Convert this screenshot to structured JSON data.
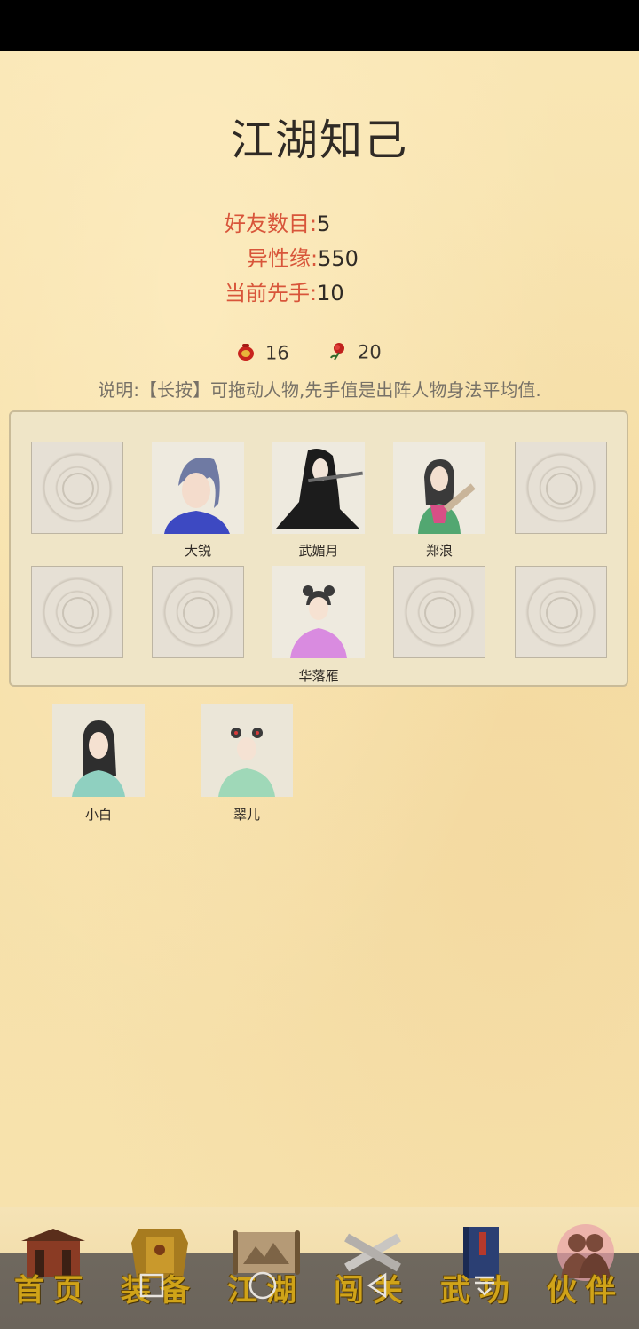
{
  "title": "江湖知己",
  "stats": [
    {
      "label": "好友数目:",
      "value": "5"
    },
    {
      "label": "异性缘:",
      "value": "550"
    },
    {
      "label": "当前先手:",
      "value": "10"
    }
  ],
  "resources": [
    {
      "icon": "red-pouch-icon",
      "value": "16"
    },
    {
      "icon": "red-rose-icon",
      "value": "20"
    }
  ],
  "note": "说明:【长按】可拖动人物,先手值是出阵人物身法平均值.",
  "formation": {
    "row1": [
      {
        "empty": true
      },
      {
        "name": "大锐"
      },
      {
        "name": "武媚月"
      },
      {
        "name": "郑浪"
      },
      {
        "empty": true
      }
    ],
    "row2": [
      {
        "empty": true
      },
      {
        "empty": true
      },
      {
        "name": "华落雁"
      },
      {
        "empty": true
      },
      {
        "empty": true
      }
    ]
  },
  "reserve": [
    {
      "name": "小白"
    },
    {
      "name": "翠儿"
    }
  ],
  "nav": [
    {
      "label": "首页",
      "icon": "house-icon"
    },
    {
      "label": "装备",
      "icon": "armor-icon"
    },
    {
      "label": "江湖",
      "icon": "scroll-map-icon"
    },
    {
      "label": "闯关",
      "icon": "crossed-swords-icon"
    },
    {
      "label": "武功",
      "icon": "book-icon"
    },
    {
      "label": "伙伴",
      "icon": "companions-icon"
    }
  ],
  "colors": {
    "accent": "#d8553a",
    "nav_gold": "#d0a318",
    "paper": "#f7e3ae"
  }
}
